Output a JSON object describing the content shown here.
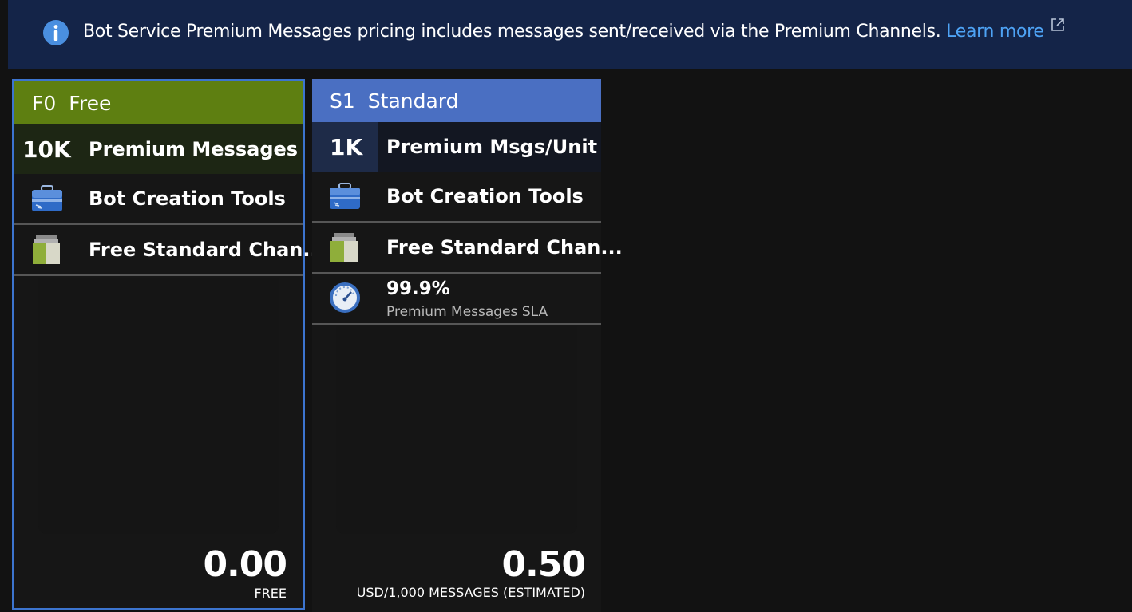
{
  "banner": {
    "icon": "info-icon",
    "text": "Bot Service Premium Messages pricing includes messages sent/received via the Premium Channels.",
    "link_label": "Learn more",
    "link_icon": "external-link-icon"
  },
  "colors": {
    "banner_bg": "#142448",
    "free_header": "#5e7f11",
    "standard_header": "#4a6fc2",
    "selected_border": "#3c74cf",
    "link": "#4ea3f5"
  },
  "tiers": [
    {
      "code": "F0",
      "name": "Free",
      "selected": true,
      "messages_count": "10K",
      "messages_label": "Premium Messages",
      "features": [
        {
          "icon": "toolbox-icon",
          "label": "Bot Creation Tools"
        },
        {
          "icon": "channels-icon",
          "label": "Free Standard Chan..."
        }
      ],
      "price": "0.00",
      "price_unit": "FREE"
    },
    {
      "code": "S1",
      "name": "Standard",
      "selected": false,
      "messages_count": "1K",
      "messages_label": "Premium Msgs/Unit",
      "features": [
        {
          "icon": "toolbox-icon",
          "label": "Bot Creation Tools"
        },
        {
          "icon": "channels-icon",
          "label": "Free Standard Chan..."
        }
      ],
      "sla": {
        "icon": "gauge-icon",
        "value": "99.9%",
        "label": "Premium Messages SLA"
      },
      "price": "0.50",
      "price_unit": "USD/1,000 MESSAGES (ESTIMATED)"
    }
  ]
}
